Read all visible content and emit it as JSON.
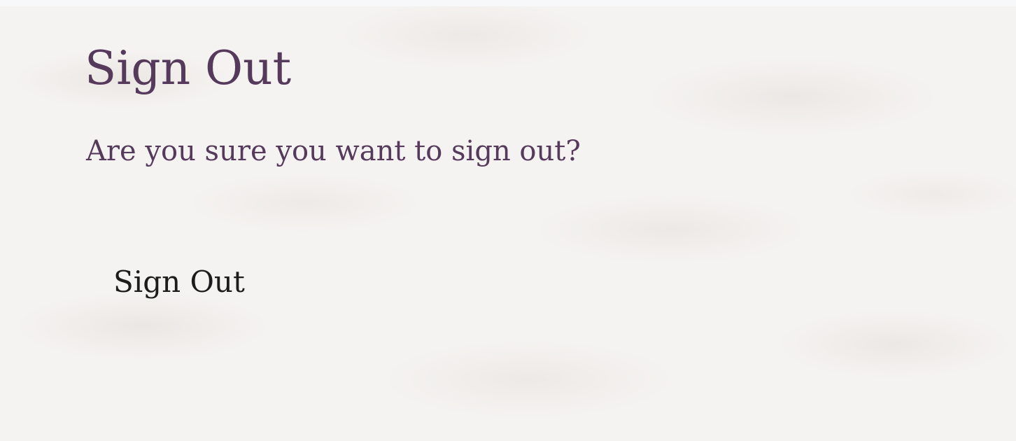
{
  "page": {
    "title": "Sign Out",
    "confirmation": "Are you sure you want to sign out?"
  },
  "form": {
    "submit_label": "Sign Out"
  },
  "colors": {
    "heading": "#563a5b",
    "button_text": "#1c1c1c",
    "background": "#f5f3f1"
  }
}
